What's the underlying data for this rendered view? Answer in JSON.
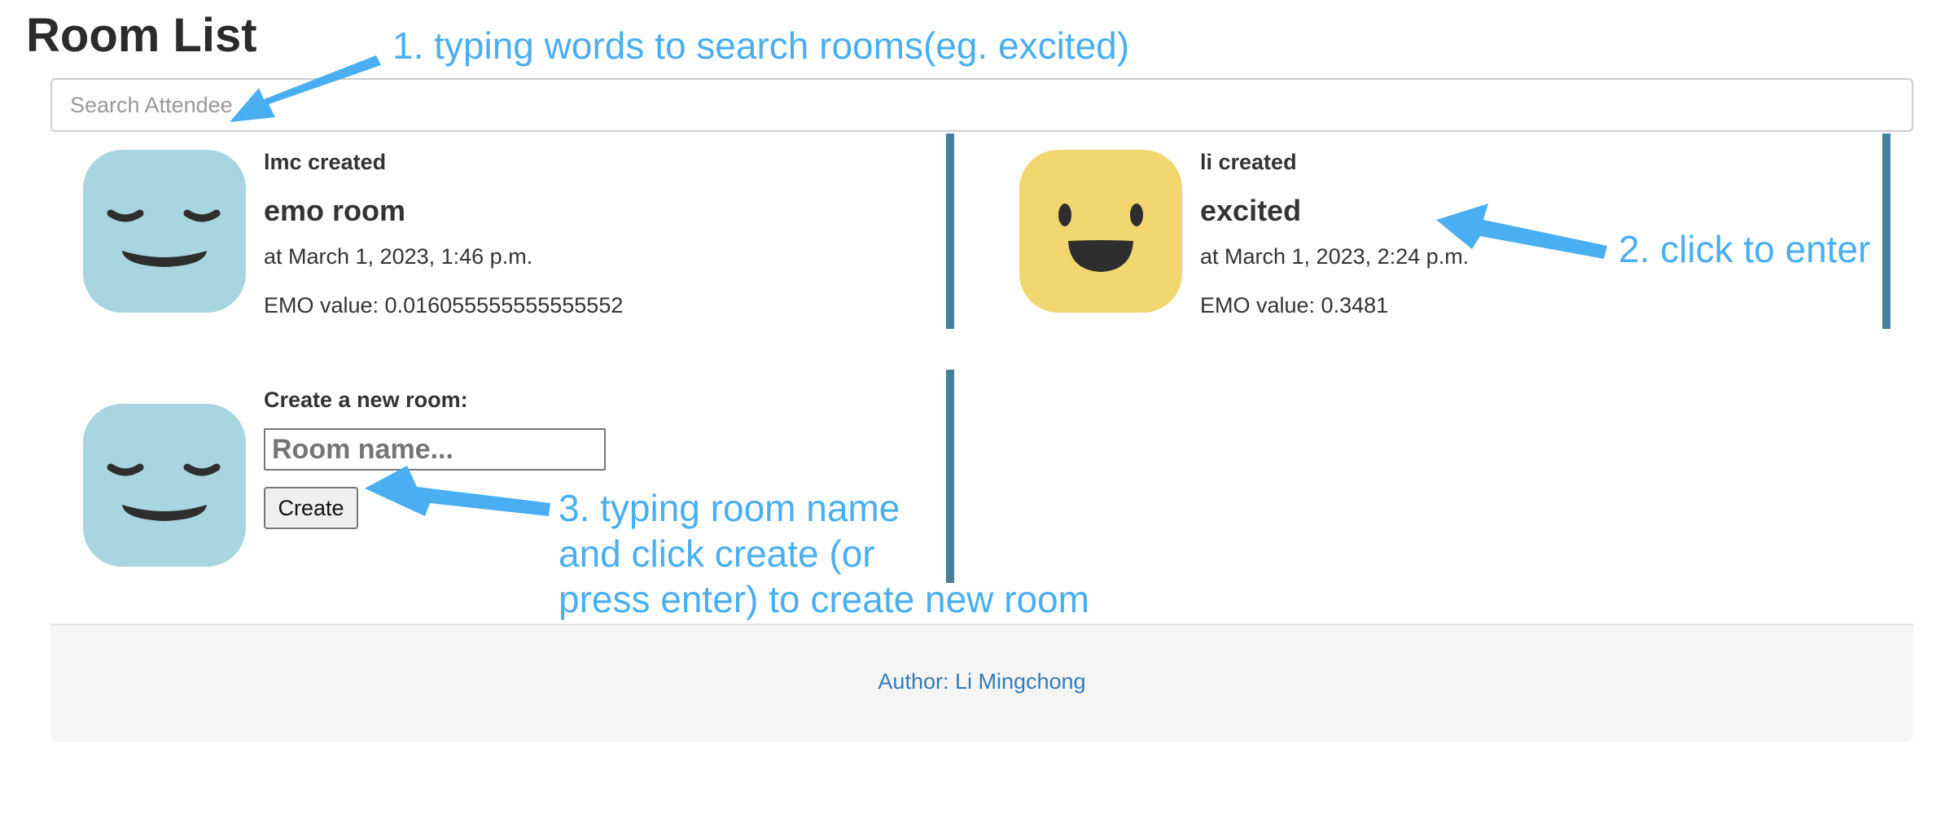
{
  "page": {
    "title": "Room List"
  },
  "search": {
    "placeholder": "Search Attendee"
  },
  "rooms": [
    {
      "creator": "lmc created",
      "name": "emo room",
      "date": "at March 1, 2023, 1:46 p.m.",
      "emo_value": "EMO value: 0.016055555555555552",
      "avatar_icon": "calm-face-icon",
      "avatar_color": "#a8d5df"
    },
    {
      "creator": "li created",
      "name": "excited",
      "date": "at March 1, 2023, 2:24 p.m.",
      "emo_value": "EMO value: 0.3481",
      "avatar_icon": "happy-face-icon",
      "avatar_color": "#f2d66f"
    }
  ],
  "create_room": {
    "label": "Create a new room:",
    "input_placeholder": "Room name...",
    "button_label": "Create",
    "avatar_icon": "calm-face-icon",
    "avatar_color": "#a8d5df"
  },
  "footer": {
    "author": "Author: Li Mingchong"
  },
  "annotations": {
    "search_hint": "1. typing words to search rooms(eg. excited)",
    "enter_hint": "2. click to enter",
    "create_hint_line1": "3. typing room name",
    "create_hint_line2": "and click create (or",
    "create_hint_line3": "press enter) to create new room"
  },
  "colors": {
    "accent_divider": "#457f9a",
    "annotation": "#4aaef2",
    "link": "#337ab7"
  }
}
